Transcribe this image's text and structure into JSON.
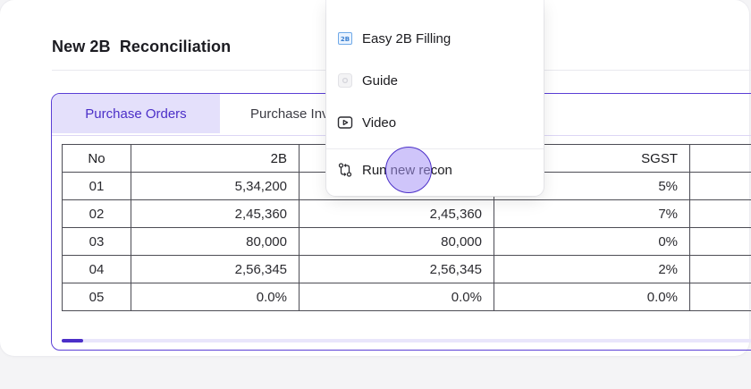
{
  "page": {
    "title": "New 2B  Reconciliation"
  },
  "tabs": [
    {
      "label": "Purchase Orders",
      "active": true
    },
    {
      "label": "Purchase Inv",
      "active": false
    }
  ],
  "table": {
    "headers": {
      "no": "No",
      "col_2b": "2B",
      "col_purchase": "",
      "col_sgst": "SGST"
    },
    "rows": [
      {
        "no": "01",
        "b2": "5,34,200",
        "purchase": "",
        "sgst": "5%"
      },
      {
        "no": "02",
        "b2": "2,45,360",
        "purchase": "2,45,360",
        "sgst": "7%"
      },
      {
        "no": "03",
        "b2": "80,000",
        "purchase": "80,000",
        "sgst": "0%"
      },
      {
        "no": "04",
        "b2": "2,56,345",
        "purchase": "2,56,345",
        "sgst": "2%"
      },
      {
        "no": "05",
        "b2": "0.0%",
        "purchase": "0.0%",
        "sgst": "0.0%"
      }
    ]
  },
  "menu": {
    "items": [
      {
        "label": "Easy 2B Filling",
        "icon": "2b-badge-icon",
        "badge_text": "2B"
      },
      {
        "label": "Guide",
        "icon": "guide-icon"
      },
      {
        "label": "Video",
        "icon": "play-icon"
      },
      {
        "label": "Run new recon",
        "icon": "git-compare-icon"
      }
    ]
  },
  "scroll": {
    "position": 0
  },
  "colors": {
    "accent": "#4b2fc8",
    "tab_active_bg": "#e4e0fb",
    "panel_border": "#5a3fd6",
    "cursor_fill": "#a896f5"
  }
}
